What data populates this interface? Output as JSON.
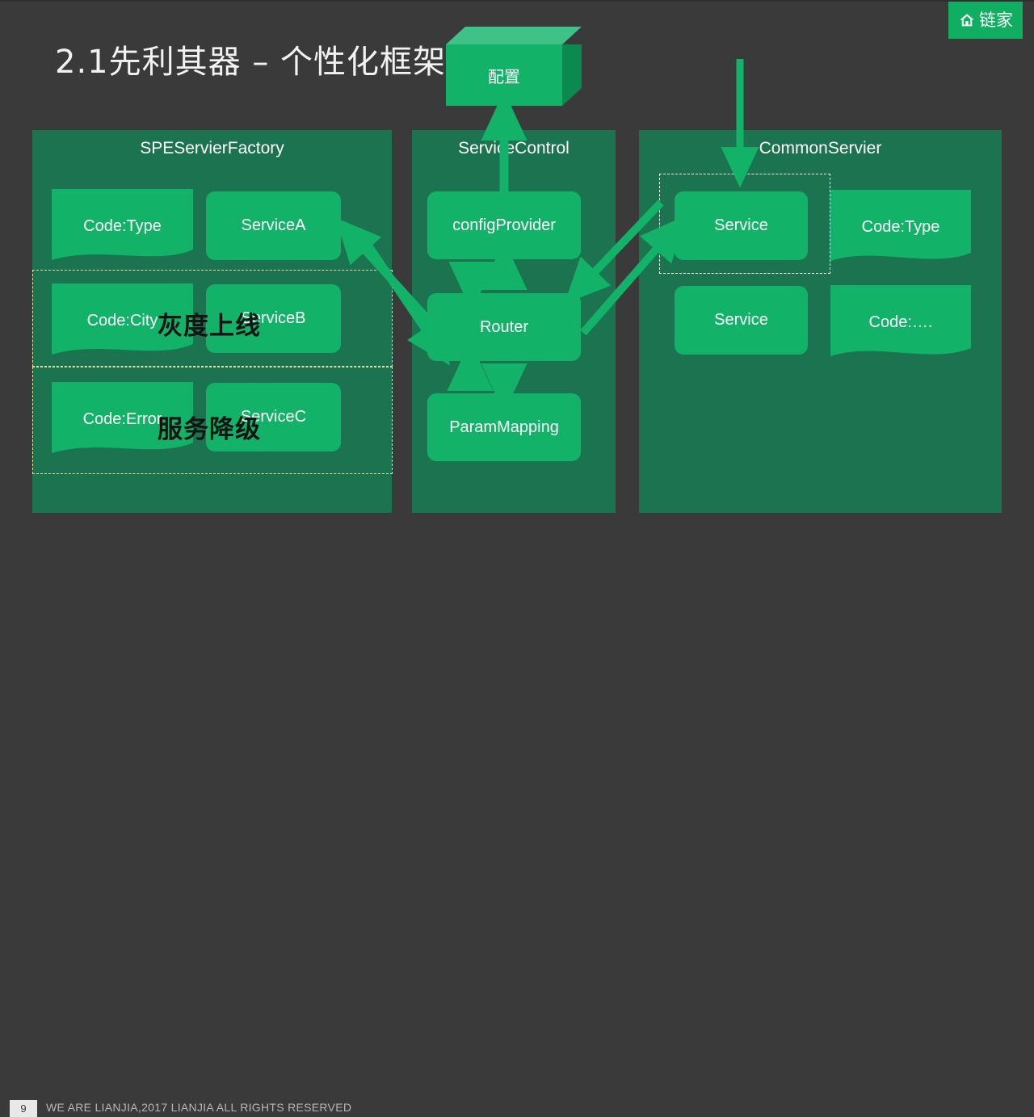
{
  "slide": {
    "title": "2.1先利其器 – 个性化框架",
    "background_color": "#3a3a3a",
    "accent_green": "#12b368",
    "panel_green": "#1c7350"
  },
  "logo": {
    "text": "链家",
    "icon": "house-icon",
    "background_color": "#0fae60"
  },
  "config_cube": {
    "label": "配置"
  },
  "panels": [
    {
      "id": "spe",
      "title": "SPEServierFactory",
      "rows": [
        {
          "code": "Code:Type",
          "service": "ServiceA"
        },
        {
          "code": "Code:City",
          "service": "ServiceB"
        },
        {
          "code": "Code:Error",
          "service": "ServiceC"
        }
      ]
    },
    {
      "id": "service-control",
      "title": "ServiceControl",
      "nodes": [
        {
          "label": "configProvider"
        },
        {
          "label": "Router"
        },
        {
          "label": "ParamMapping"
        }
      ]
    },
    {
      "id": "common-servier",
      "title": "CommonServier",
      "rows": [
        {
          "service": "Service",
          "code": "Code:Type"
        },
        {
          "service": "Service",
          "code": "Code:…."
        }
      ]
    }
  ],
  "annotations": [
    {
      "text": "灰度上线"
    },
    {
      "text": "服务降级"
    }
  ],
  "footer": {
    "page_number": "9",
    "copyright": "WE ARE LIANJIA,2017 LIANJIA  ALL RIGHTS RESERVED"
  }
}
